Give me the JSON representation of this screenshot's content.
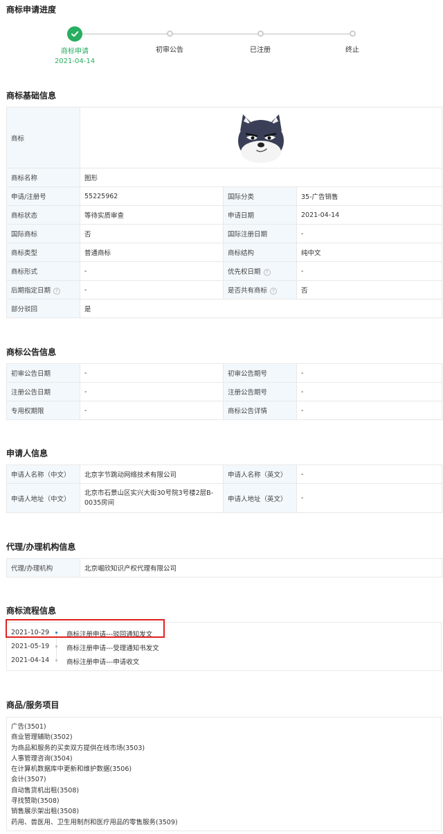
{
  "progress": {
    "title": "商标申请进度",
    "steps": [
      {
        "label": "商标申请",
        "date": "2021-04-14",
        "done": true
      },
      {
        "label": "初审公告",
        "done": false
      },
      {
        "label": "已注册",
        "done": false
      },
      {
        "label": "终止",
        "done": false
      }
    ]
  },
  "basic": {
    "title": "商标基础信息",
    "logo_label": "商标",
    "rows": [
      {
        "k1": "商标名称",
        "v1": "图形"
      },
      {
        "k1": "申请/注册号",
        "v1": "55225962",
        "k2": "国际分类",
        "v2": "35-广告销售"
      },
      {
        "k1": "商标状态",
        "v1": "等待实质审查",
        "k2": "申请日期",
        "v2": "2021-04-14"
      },
      {
        "k1": "国际商标",
        "v1": "否",
        "k2": "国际注册日期",
        "v2": "-"
      },
      {
        "k1": "商标类型",
        "v1": "普通商标",
        "k2": "商标结构",
        "v2": "纯中文"
      },
      {
        "k1": "商标形式",
        "v1": "-",
        "k2": "优先权日期",
        "v2": "-"
      },
      {
        "k1": "后期指定日期",
        "v1": "-",
        "k2": "是否共有商标",
        "v2": "否"
      },
      {
        "k1": "部分驳回",
        "v1": "是"
      }
    ],
    "help_glyph": "?"
  },
  "announce": {
    "title": "商标公告信息",
    "rows": [
      {
        "k1": "初审公告日期",
        "v1": "-",
        "k2": "初审公告期号",
        "v2": "-"
      },
      {
        "k1": "注册公告日期",
        "v1": "-",
        "k2": "注册公告期号",
        "v2": "-"
      },
      {
        "k1": "专用权期限",
        "v1": "-",
        "k2": "商标公告详情",
        "v2": "-"
      }
    ]
  },
  "applicant": {
    "title": "申请人信息",
    "rows": [
      {
        "k1": "申请人名称（中文）",
        "v1": "北京字节跳动网络技术有限公司",
        "k2": "申请人名称（英文）",
        "v2": "-"
      },
      {
        "k1": "申请人地址（中文）",
        "v1": "北京市石景山区实兴大街30号院3号楼2层B-0035房间",
        "k2": "申请人地址（英文）",
        "v2": "-"
      }
    ]
  },
  "agent": {
    "title": "代理/办理机构信息",
    "key": "代理/办理机构",
    "value": "北京崛欣知识产权代理有限公司"
  },
  "flow": {
    "title": "商标流程信息",
    "items": [
      {
        "date": "2021-10-29",
        "text": "商标注册申请---驳回通知发文"
      },
      {
        "date": "2021-05-19",
        "text": "商标注册申请---受理通知书发文"
      },
      {
        "date": "2021-04-14",
        "text": "商标注册申请---申请收文"
      }
    ]
  },
  "goods": {
    "title": "商品/服务项目",
    "items": [
      "广告(3501)",
      "商业管理辅助(3502)",
      "为商品和服务的买卖双方提供在线市场(3503)",
      "人事管理咨询(3504)",
      "在计算机数据库中更新和维护数据(3506)",
      "会计(3507)",
      "自动售货机出租(3508)",
      "寻找赞助(3508)",
      "销售展示架出租(3508)",
      "药用、兽医用、卫生用制剂和医疗用品的零售服务(3509)"
    ]
  },
  "colors": {
    "done": "#27ae60",
    "link": "#1a7ac8",
    "highlight": "#e02020"
  }
}
